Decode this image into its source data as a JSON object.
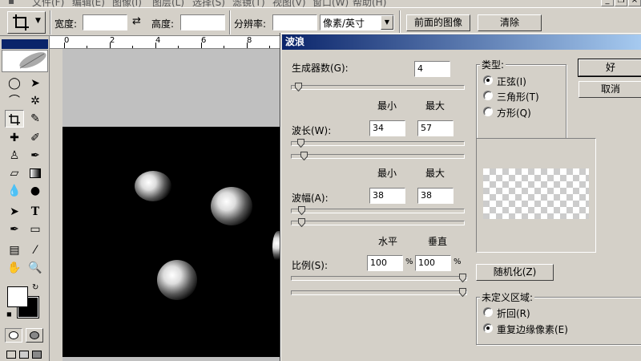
{
  "menubar": {
    "items": [
      "文件(F)",
      "编辑(E)",
      "图像(I)",
      "图层(L)",
      "选择(S)",
      "滤镜(T)",
      "视图(V)",
      "窗口(W)",
      "帮助(H)"
    ]
  },
  "options_bar": {
    "width_label": "宽度:",
    "height_label": "高度:",
    "resolution_label": "分辨率:",
    "unit_value": "像素/英寸",
    "front_image_button": "前面的图像",
    "clear_button": "清除"
  },
  "ruler": {
    "numbers": [
      "0",
      "2",
      "4",
      "6",
      "8"
    ]
  },
  "dialog": {
    "title": "波浪",
    "generators": {
      "label": "生成器数(G):",
      "value": "4",
      "fraction": 0.02
    },
    "min_header": "最小",
    "max_header": "最大",
    "wavelength": {
      "label": "波长(W):",
      "min": "34",
      "max": "57",
      "min_fraction": 0.035,
      "max_fraction": 0.055
    },
    "amplitude": {
      "label": "波幅(A):",
      "min": "38",
      "max": "38",
      "min_fraction": 0.04,
      "max_fraction": 0.04
    },
    "horizontal_header": "水平",
    "vertical_header": "垂直",
    "scale": {
      "label": "比例(S):",
      "horizontal": "100",
      "vertical": "100",
      "unit": "%",
      "h_fraction": 1.0,
      "v_fraction": 1.0
    },
    "ok_button": "好",
    "cancel_button": "取消",
    "type_group": {
      "title": "类型:",
      "options": [
        {
          "label": "正弦(I)",
          "selected": true
        },
        {
          "label": "三角形(T)",
          "selected": false
        },
        {
          "label": "方形(Q)",
          "selected": false
        }
      ]
    },
    "randomize_button": "随机化(Z)",
    "undefined_group": {
      "title": "未定义区域:",
      "options": [
        {
          "label": "折回(R)",
          "selected": false
        },
        {
          "label": "重复边缘像素(E)",
          "selected": true
        }
      ]
    }
  }
}
